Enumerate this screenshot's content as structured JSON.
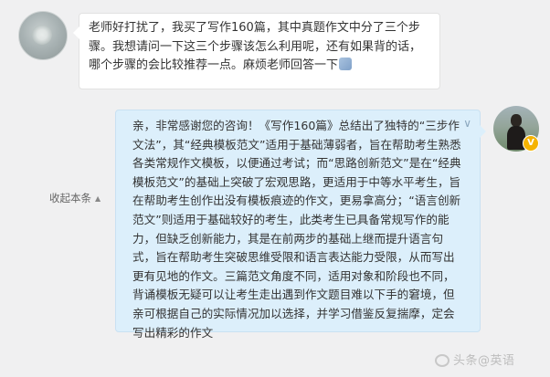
{
  "question": {
    "text": "老师好打扰了，我买了写作160篇，其中真题作文中分了三个步骤。我想请问一下这三个步骤该怎么利用呢，还有如果背的话，哪个步骤的会比较推荐一点。麻烦老师回答一下",
    "emoji_icon": "praying-hands-icon"
  },
  "answer": {
    "text": "亲，非常感谢您的咨询！《写作160篇》总结出了独特的“三步作文法”，其“经典模板范文”适用于基础薄弱者，旨在帮助考生熟悉各类常规作文模板，以便通过考试；而“思路创新范文”是在“经典模板范文”的基础上突破了宏观思路，更适用于中等水平考生，旨在帮助考生创作出没有模板痕迹的作文，更易拿高分；“语言创新范文”则适用于基础较好的考生，此类考生已具备常规写作的能力，但缺乏创新能力，其是在前两步的基础上继而提升语言句式，旨在帮助考生突破思维受限和语言表达能力受限，从而写出更有见地的作文。三篇范文角度不同，适用对象和阶段也不同，背诵模板无疑可以让考生走出遇到作文题目难以下手的窘境，但亲可根据自己的实际情况加以选择，并学习借鉴反复揣摩，定会写出精彩的作文",
    "chevron_icon": "chevron-down-icon"
  },
  "sidebar": {
    "collapse_label": "收起本条"
  },
  "teacher": {
    "verified_badge": "V"
  },
  "watermark": {
    "text": "头条@英语"
  },
  "colors": {
    "answer_bubble": "#dceffb",
    "question_bubble": "#ffffff",
    "background": "#f0f0f1",
    "badge": "#f5b301"
  }
}
